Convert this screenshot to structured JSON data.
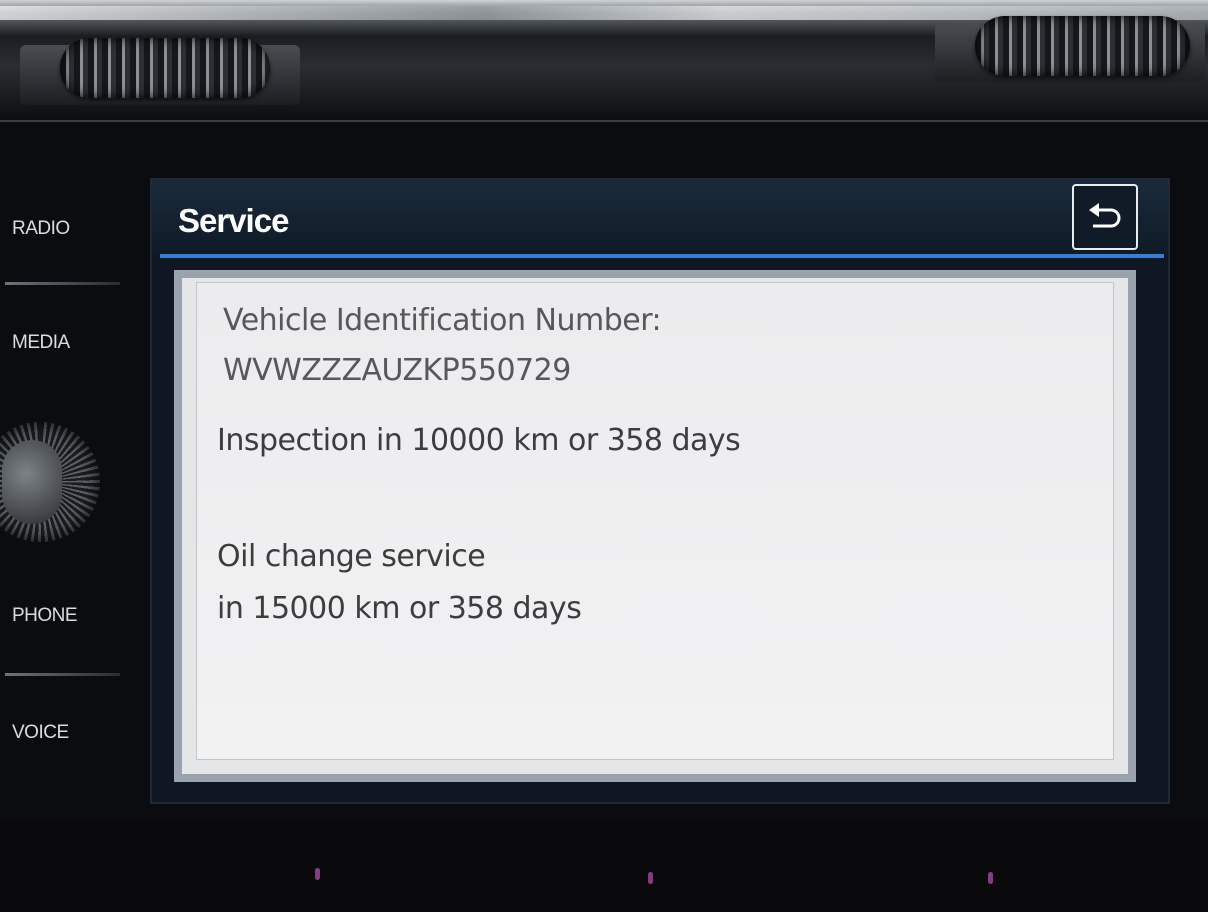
{
  "hardware_buttons": {
    "radio": "RADIO",
    "media": "MEDIA",
    "phone": "PHONE",
    "voice": "VOICE"
  },
  "screen": {
    "title": "Service",
    "back_icon": "back-arrow-icon",
    "vin_label": "Vehicle Identification Number:",
    "vin_value": "WVWZZZAUZKP550729",
    "inspection": "Inspection in 10000 km or 358 days",
    "oil_change_line1": "Oil change service",
    "oil_change_line2": "in 15000 km or 358 days"
  },
  "colors": {
    "accent_line": "#2f82d8",
    "panel_bg": "#ececee",
    "header_bg": "#0f1a26"
  }
}
